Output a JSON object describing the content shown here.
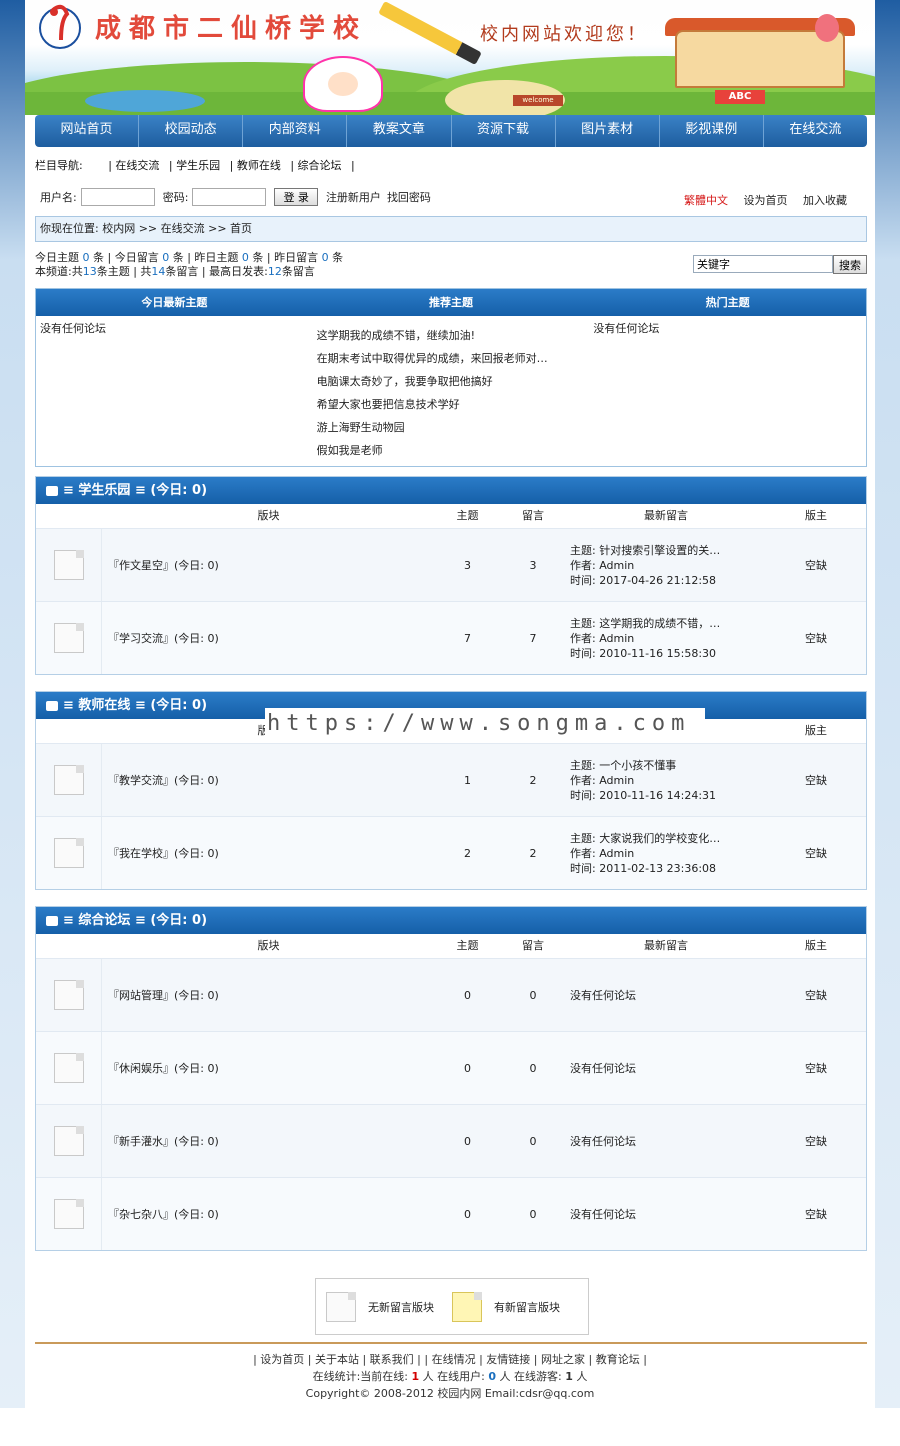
{
  "banner": {
    "school_name": "成都市二仙桥学校",
    "welcome": "校内网站欢迎您！",
    "abc": "ABC",
    "welcome_sign": "welcome"
  },
  "nav": [
    "网站首页",
    "校园动态",
    "内部资料",
    "教案文章",
    "资源下载",
    "图片素材",
    "影视课例",
    "在线交流"
  ],
  "colnav": {
    "label": "栏目导航:",
    "items": [
      "| 在线交流",
      "| 学生乐园",
      "| 教师在线",
      "| 综合论坛",
      "|"
    ]
  },
  "login": {
    "user_label": "用户名:",
    "pass_label": "密码:",
    "button": "登 录",
    "register": "注册新用户",
    "forgot": "找回密码"
  },
  "toplinks": {
    "trad": "繁體中文",
    "home": "设为首页",
    "fav": "加入收藏"
  },
  "crumb": "你现在位置: 校内网 >> 在线交流 >> 首页",
  "stats": {
    "line1": [
      "今日主题",
      "0",
      "条 | 今日留言",
      "0",
      "条 | 昨日主题",
      "0",
      "条 | 昨日留言",
      "0",
      "条"
    ],
    "line2": [
      "本频道:共",
      "13",
      "条主题 | 共",
      "14",
      "条留言 | 最高日发表:",
      "12",
      "条留言"
    ]
  },
  "search": {
    "placeholder": "关键字",
    "button": "搜索"
  },
  "top_topics": {
    "headers": [
      "今日最新主题",
      "推荐主题",
      "热门主题"
    ],
    "today": "没有任何论坛",
    "recommend": [
      "这学期我的成绩不错，继续加油!",
      "在期末考试中取得优异的成绩，来回报老师对…",
      "电脑课太奇妙了，我要争取把他搞好",
      "希望大家也要把信息技术学好",
      "游上海野生动物园",
      "假如我是老师"
    ],
    "hot": "没有任何论坛"
  },
  "columns": {
    "board": "版块",
    "topics": "主题",
    "replies": "留言",
    "last": "最新留言",
    "mod": "版主"
  },
  "sections": [
    {
      "title": "≡ 学生乐园  ≡ (今日: 0)",
      "rows": [
        {
          "name": "『作文星空』(今日: 0)",
          "topics": "3",
          "replies": "3",
          "last": [
            "主题: 针对搜索引擎设置的关…",
            "作者: Admin",
            "时间: 2017-04-26 21:12:58"
          ],
          "mod": "空缺"
        },
        {
          "name": "『学习交流』(今日: 0)",
          "topics": "7",
          "replies": "7",
          "last": [
            "主题: 这学期我的成绩不错，…",
            "作者: Admin",
            "时间: 2010-11-16 15:58:30"
          ],
          "mod": "空缺"
        }
      ]
    },
    {
      "title": "≡ 教师在线  ≡ (今日: 0)",
      "rows": [
        {
          "name": "『教学交流』(今日: 0)",
          "topics": "1",
          "replies": "2",
          "last": [
            "主题: 一个小孩不懂事",
            "作者: Admin",
            "时间: 2010-11-16 14:24:31"
          ],
          "mod": "空缺"
        },
        {
          "name": "『我在学校』(今日: 0)",
          "topics": "2",
          "replies": "2",
          "last": [
            "主题: 大家说我们的学校变化…",
            "作者: Admin",
            "时间: 2011-02-13 23:36:08"
          ],
          "mod": "空缺"
        }
      ]
    },
    {
      "title": "≡ 综合论坛  ≡ (今日: 0)",
      "rows": [
        {
          "name": "『网站管理』(今日: 0)",
          "topics": "0",
          "replies": "0",
          "last": [
            "没有任何论坛"
          ],
          "mod": "空缺"
        },
        {
          "name": "『休闲娱乐』(今日: 0)",
          "topics": "0",
          "replies": "0",
          "last": [
            "没有任何论坛"
          ],
          "mod": "空缺"
        },
        {
          "name": "『新手灌水』(今日: 0)",
          "topics": "0",
          "replies": "0",
          "last": [
            "没有任何论坛"
          ],
          "mod": "空缺"
        },
        {
          "name": "『杂七杂八』(今日: 0)",
          "topics": "0",
          "replies": "0",
          "last": [
            "没有任何论坛"
          ],
          "mod": "空缺"
        }
      ]
    }
  ],
  "legend": {
    "no_new": "无新留言版块",
    "has_new": "有新留言版块"
  },
  "watermark": "https://www.songma.com",
  "footer": {
    "links": [
      "| 设为首页",
      "| 关于本站",
      "| 联系我们",
      "|",
      "| 在线情况",
      "| 友情链接",
      "| 网址之家",
      "| 教育论坛",
      "|"
    ],
    "online": [
      "在线统计:当前在线:",
      "1",
      "人 在线用户:",
      "0",
      "人 在线游客:",
      "1",
      "人"
    ],
    "copyright": "Copyright© 2008-2012 校园内网 Email:cdsr@qq.com"
  }
}
